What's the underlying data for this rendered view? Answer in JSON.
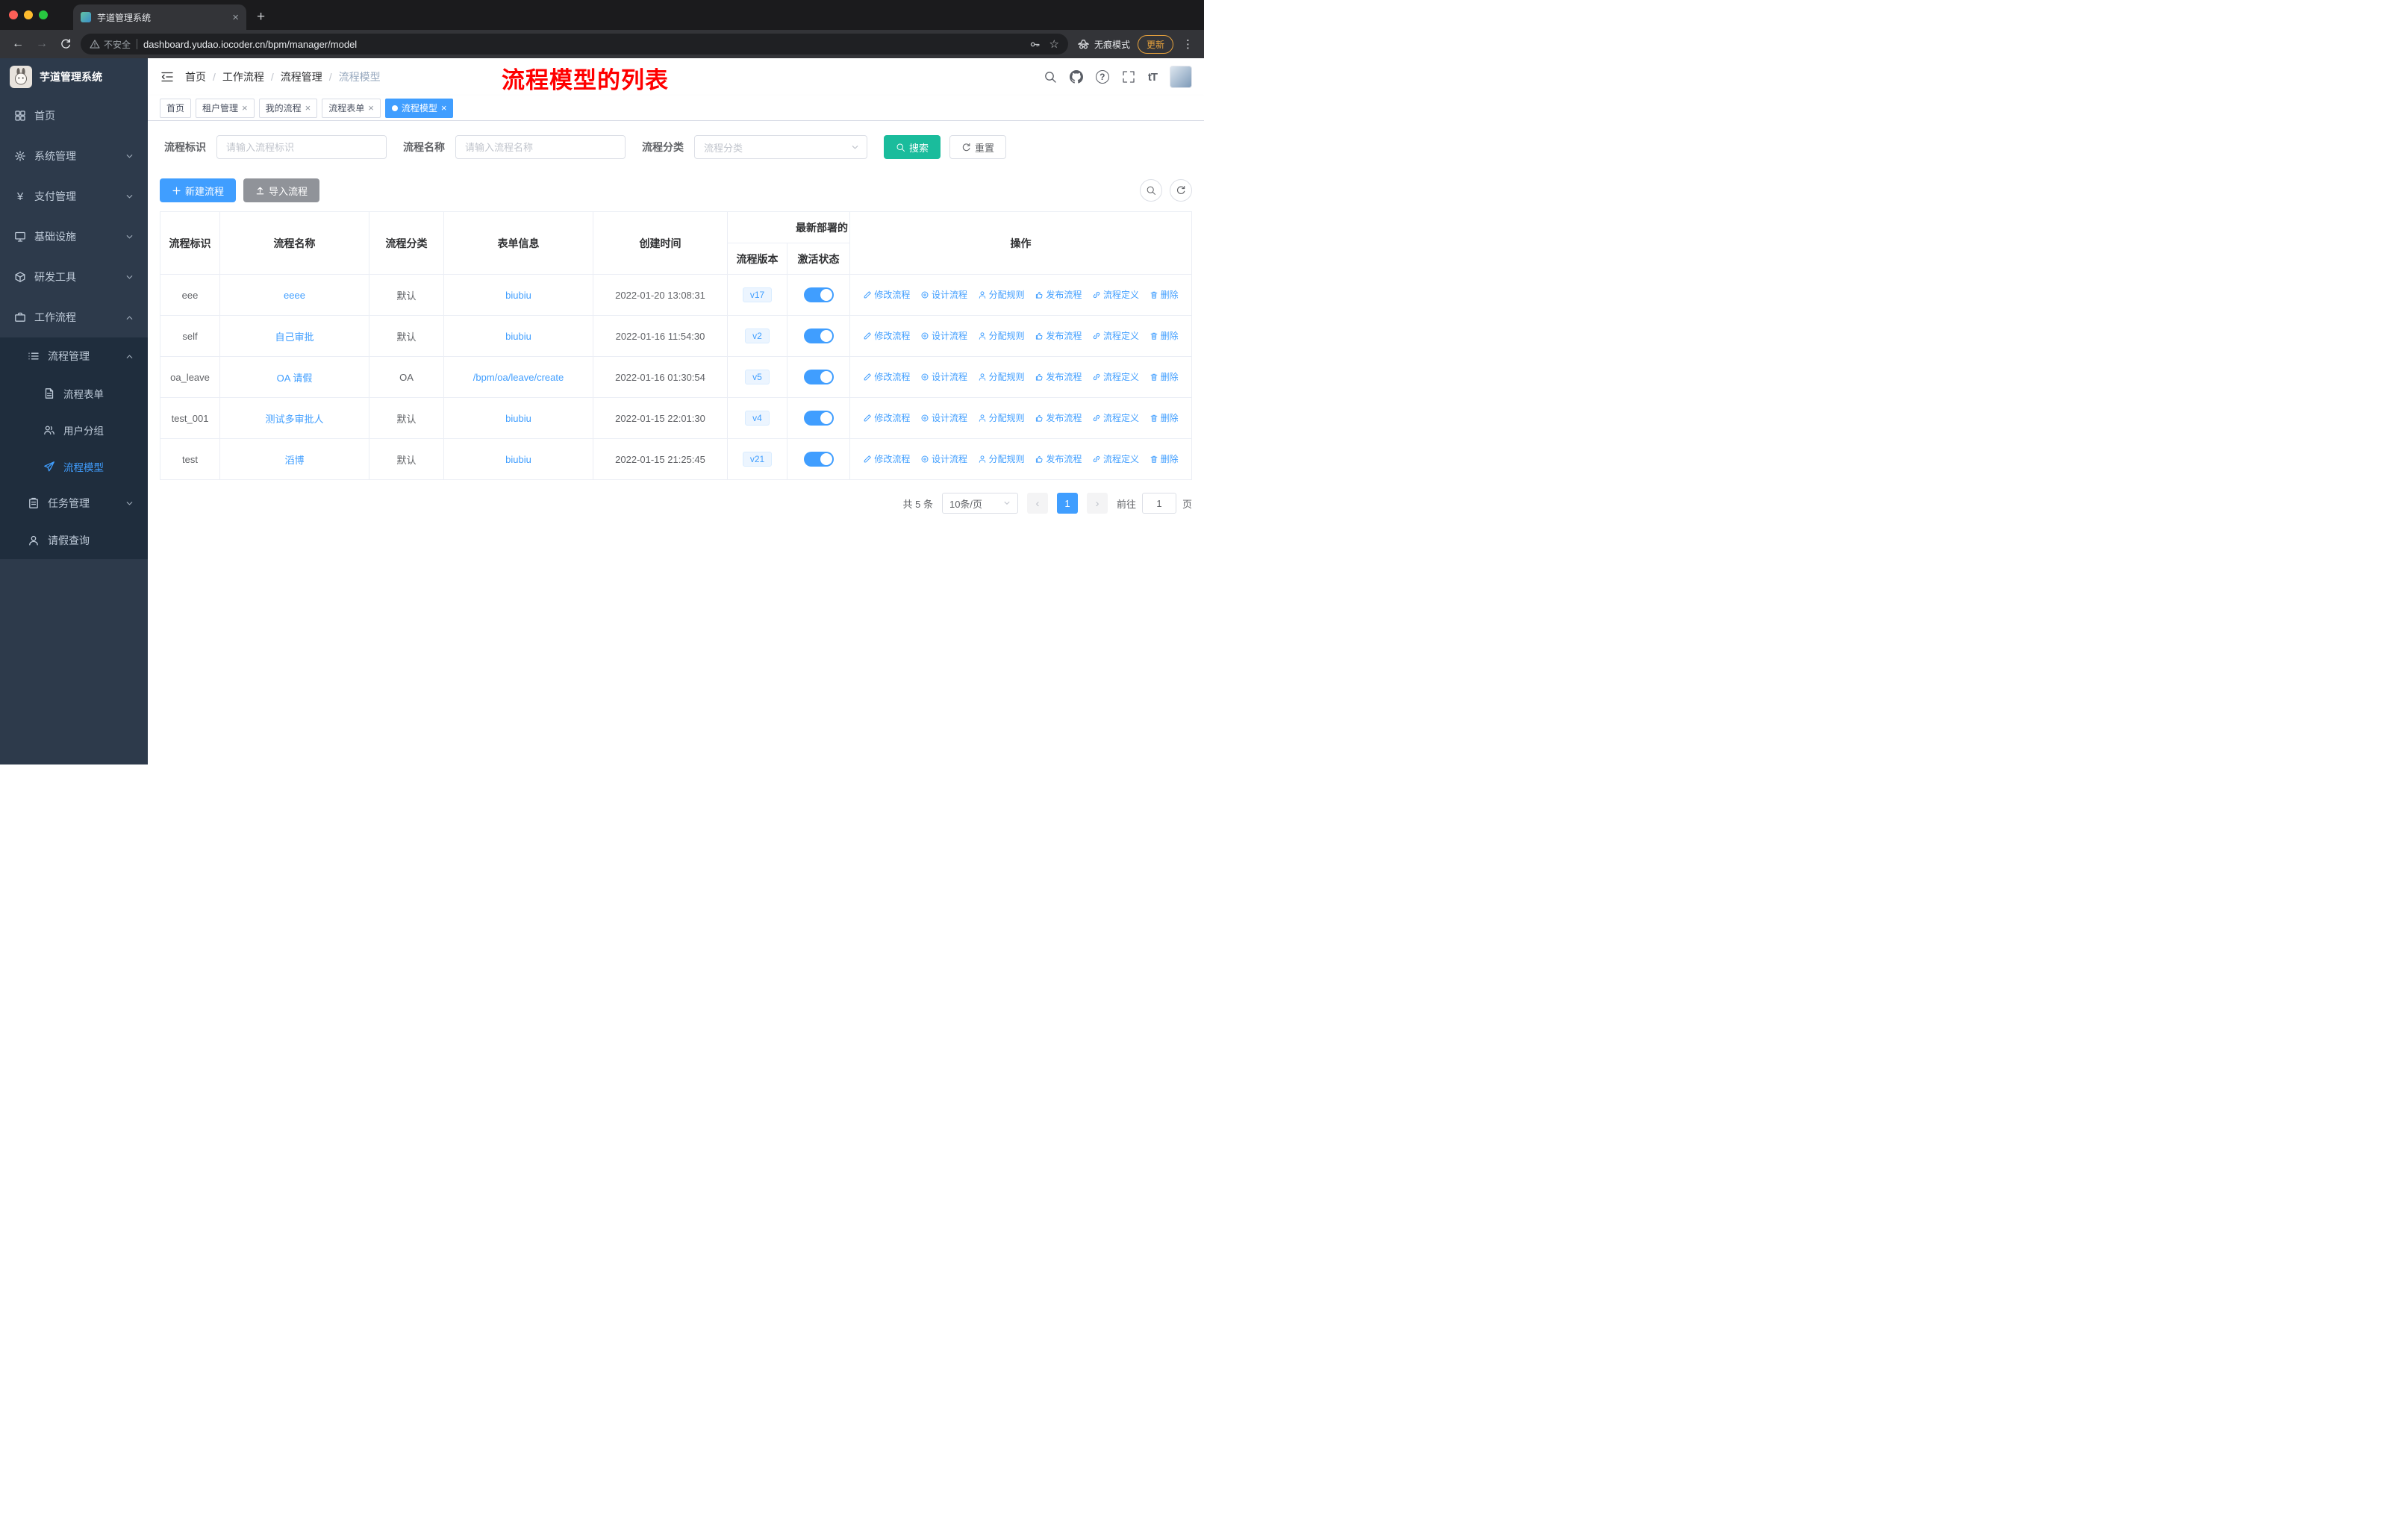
{
  "browser": {
    "tab_title": "芋道管理系统",
    "security_label": "不安全",
    "url": "dashboard.yudao.iocoder.cn/bpm/manager/model",
    "incognito_label": "无痕模式",
    "update_label": "更新"
  },
  "sidebar": {
    "title": "芋道管理系统",
    "menu": {
      "home": "首页",
      "system": "系统管理",
      "pay": "支付管理",
      "infra": "基础设施",
      "devtools": "研发工具",
      "workflow": "工作流程",
      "process_mgmt": "流程管理",
      "process_form": "流程表单",
      "user_group": "用户分组",
      "process_model": "流程模型",
      "task_mgmt": "任务管理",
      "leave_query": "请假查询"
    }
  },
  "header": {
    "breadcrumb": [
      "首页",
      "工作流程",
      "流程管理",
      "流程模型"
    ],
    "annotation": "流程模型的列表"
  },
  "tags": {
    "items": [
      {
        "label": "首页"
      },
      {
        "label": "租户管理"
      },
      {
        "label": "我的流程"
      },
      {
        "label": "流程表单"
      },
      {
        "label": "流程模型"
      }
    ]
  },
  "filter": {
    "id_label": "流程标识",
    "id_placeholder": "请输入流程标识",
    "name_label": "流程名称",
    "name_placeholder": "请输入流程名称",
    "category_label": "流程分类",
    "category_placeholder": "流程分类",
    "search_label": "搜索",
    "reset_label": "重置"
  },
  "toolbar": {
    "create_label": "新建流程",
    "import_label": "导入流程"
  },
  "table": {
    "headers": {
      "id": "流程标识",
      "name": "流程名称",
      "category": "流程分类",
      "form": "表单信息",
      "created": "创建时间",
      "deploy_group": "最新部署的",
      "version": "流程版本",
      "active": "激活状态",
      "ops": "操作"
    },
    "actions": [
      "修改流程",
      "设计流程",
      "分配规则",
      "发布流程",
      "流程定义",
      "删除"
    ],
    "rows": [
      {
        "id": "eee",
        "name": "eeee",
        "category": "默认",
        "form": "biubiu",
        "created": "2022-01-20 13:08:31",
        "version": "v17"
      },
      {
        "id": "self",
        "name": "自己审批",
        "category": "默认",
        "form": "biubiu",
        "created": "2022-01-16 11:54:30",
        "version": "v2"
      },
      {
        "id": "oa_leave",
        "name": "OA 请假",
        "category": "OA",
        "form": "/bpm/oa/leave/create",
        "created": "2022-01-16 01:30:54",
        "version": "v5"
      },
      {
        "id": "test_001",
        "name": "测试多审批人",
        "category": "默认",
        "form": "biubiu",
        "created": "2022-01-15 22:01:30",
        "version": "v4"
      },
      {
        "id": "test",
        "name": "滔博",
        "category": "默认",
        "form": "biubiu",
        "created": "2022-01-15 21:25:45",
        "version": "v21"
      }
    ]
  },
  "pagination": {
    "total": "共 5 条",
    "page_size": "10条/页",
    "current_page": "1",
    "goto_label": "前往",
    "goto_value": "1",
    "goto_suffix": "页"
  },
  "colors": {
    "primary": "#409eff",
    "search_button": "#1abc9c",
    "annotation_red": "#ff0000",
    "sidebar_bg": "#2d3a4b",
    "submenu_bg": "#1f2d3d"
  }
}
